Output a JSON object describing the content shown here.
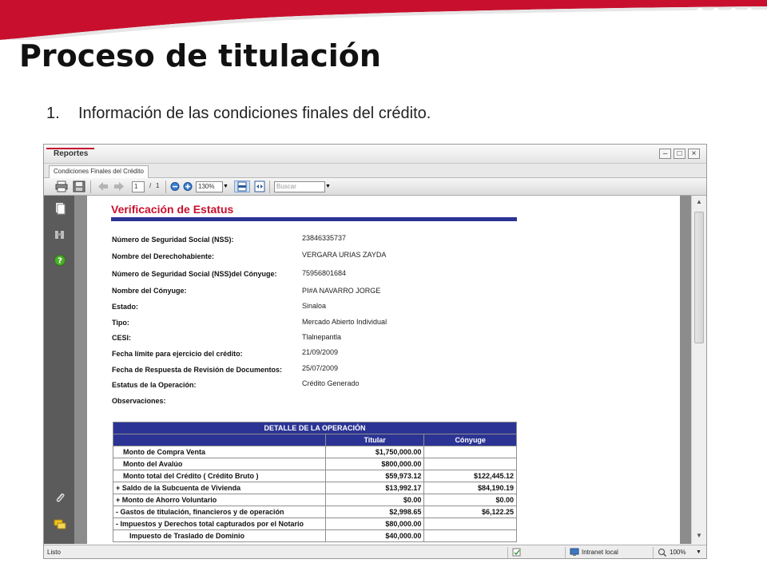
{
  "slide": {
    "title": "Proceso de titulación",
    "bullet_number": "1.",
    "bullet_text": "Información de las condiciones finales del crédito.",
    "logo_text": "INFONAVIT",
    "colors": {
      "band": "#c8102e",
      "navy": "#2b3494"
    }
  },
  "window": {
    "title": "Reportes",
    "tab": "Condiciones Finales del Crédito",
    "controls": [
      "minimize-icon",
      "restore-icon",
      "close-icon"
    ]
  },
  "toolbar": {
    "page_current": "1",
    "page_separator": "/",
    "page_total": "1",
    "zoom": "130%",
    "search_placeholder": "Buscar"
  },
  "report": {
    "title": "Verificación de Estatus",
    "fields": [
      {
        "label": "Número de Seguridad Social (NSS):",
        "value": "23846335737"
      },
      {
        "label": "Nombre del Derechohabiente:",
        "value": "VERGARA URIAS ZAYDA"
      },
      {
        "label": "Número de Seguridad Social (NSS)del Cónyuge:",
        "value": "75956801684"
      },
      {
        "label": "Nombre del Cónyuge:",
        "value": "PI#A NAVARRO JORGE"
      },
      {
        "label": "Estado:",
        "value": "Sinaloa"
      },
      {
        "label": "Tipo:",
        "value": "Mercado Abierto Individual"
      },
      {
        "label": "CESI:",
        "value": "Tlalnepantla"
      },
      {
        "label": "Fecha límite para ejercicio del crédito:",
        "value": "21/09/2009"
      },
      {
        "label": "Fecha de Respuesta de Revisión de Documentos:",
        "value": "25/07/2009"
      },
      {
        "label": "Estatus de la Operación:",
        "value": "Crédito Generado"
      },
      {
        "label": "Observaciones:",
        "value": ""
      }
    ],
    "table": {
      "title": "DETALLE DE LA OPERACIÓN",
      "columns": [
        "",
        "Titular",
        "Cónyuge"
      ],
      "rows": [
        {
          "label": "Monto de Compra Venta",
          "titular": "$1,750,000.00",
          "conyuge": ""
        },
        {
          "label": "Monto del Avalúo",
          "titular": "$800,000.00",
          "conyuge": ""
        },
        {
          "label": "Monto total del Crédito ( Crédito Bruto )",
          "titular": "$59,973.12",
          "conyuge": "$122,445.12"
        },
        {
          "label": "+ Saldo de la Subcuenta de Vivienda",
          "titular": "$13,992.17",
          "conyuge": "$84,190.19"
        },
        {
          "label": "+ Monto de Ahorro Voluntario",
          "titular": "$0.00",
          "conyuge": "$0.00"
        },
        {
          "label": "- Gastos de titulación, financieros y de operación",
          "titular": "$2,998.65",
          "conyuge": "$6,122.25"
        },
        {
          "label": "- Impuestos y Derechos total capturados por el Notario",
          "titular": "$80,000.00",
          "conyuge": ""
        },
        {
          "label": "Impuesto de Traslado de Dominio",
          "titular": "$40,000.00",
          "conyuge": ""
        }
      ]
    }
  },
  "statusbar": {
    "left": "Listo",
    "zone": "Intranet local",
    "zoom": "100%"
  }
}
